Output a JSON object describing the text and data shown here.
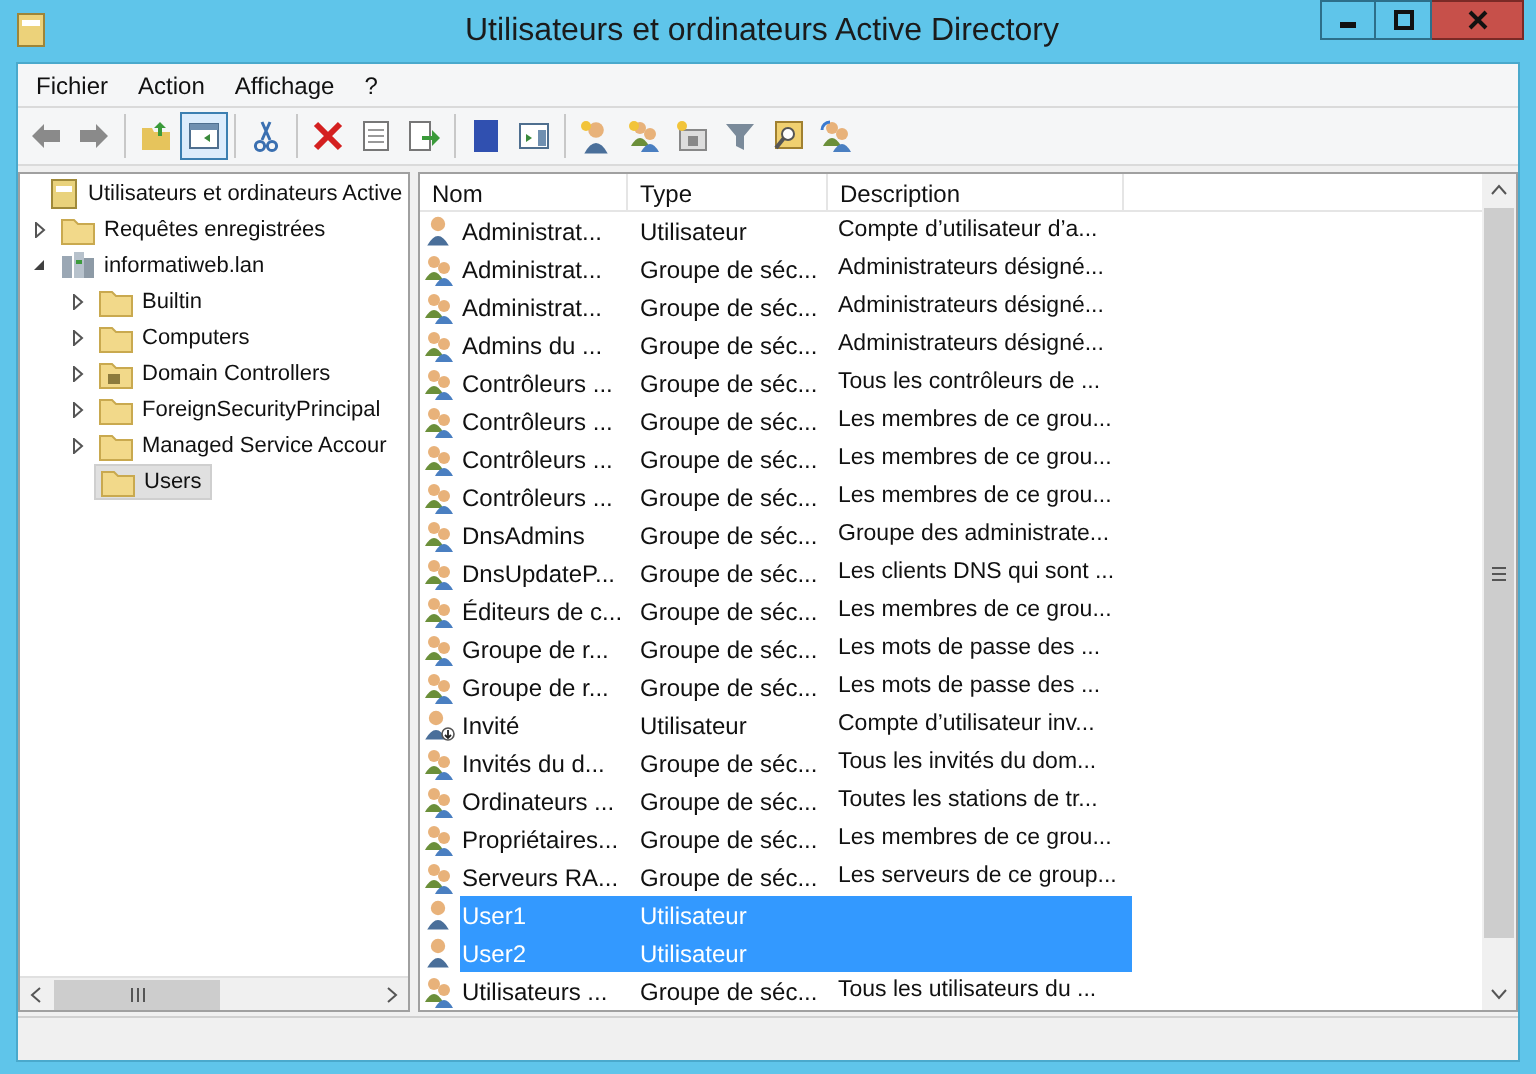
{
  "window": {
    "title": "Utilisateurs et ordinateurs Active Directory"
  },
  "menu": [
    "Fichier",
    "Action",
    "Affichage",
    "?"
  ],
  "tree": {
    "label": "Utilisateurs et ordinateurs Active",
    "kind": "root",
    "selected": false,
    "children": [
      {
        "label": "Requêtes enregistrées",
        "kind": "folder",
        "expanded": false,
        "selected": false
      },
      {
        "label": "informatiweb.lan",
        "kind": "domain",
        "expanded": true,
        "selected": false,
        "children": [
          {
            "label": "Builtin",
            "kind": "folder",
            "expanded": false,
            "selected": false
          },
          {
            "label": "Computers",
            "kind": "folder",
            "expanded": false,
            "selected": false
          },
          {
            "label": "Domain Controllers",
            "kind": "ou",
            "expanded": false,
            "selected": false
          },
          {
            "label": "ForeignSecurityPrincipal",
            "kind": "folder",
            "expanded": false,
            "selected": false
          },
          {
            "label": "Managed Service Accour",
            "kind": "folder",
            "expanded": false,
            "selected": false
          },
          {
            "label": "Users",
            "kind": "folder",
            "selected": true
          }
        ]
      }
    ]
  },
  "table": {
    "columns": [
      "Nom",
      "Type",
      "Description"
    ],
    "rows": [
      {
        "kind": "user",
        "name": "Administrat...",
        "type": "Utilisateur",
        "description": "Compte d’utilisateur d’a...",
        "selected": false
      },
      {
        "kind": "group",
        "name": "Administrat...",
        "type": "Groupe de séc...",
        "description": "Administrateurs désigné...",
        "selected": false
      },
      {
        "kind": "group",
        "name": "Administrat...",
        "type": "Groupe de séc...",
        "description": "Administrateurs désigné...",
        "selected": false
      },
      {
        "kind": "group",
        "name": "Admins du ...",
        "type": "Groupe de séc...",
        "description": "Administrateurs désigné...",
        "selected": false
      },
      {
        "kind": "group",
        "name": "Contrôleurs ...",
        "type": "Groupe de séc...",
        "description": "Tous les contrôleurs de ...",
        "selected": false
      },
      {
        "kind": "group",
        "name": "Contrôleurs ...",
        "type": "Groupe de séc...",
        "description": "Les membres de ce grou...",
        "selected": false
      },
      {
        "kind": "group",
        "name": "Contrôleurs ...",
        "type": "Groupe de séc...",
        "description": "Les membres de ce grou...",
        "selected": false
      },
      {
        "kind": "group",
        "name": "Contrôleurs ...",
        "type": "Groupe de séc...",
        "description": "Les membres de ce grou...",
        "selected": false
      },
      {
        "kind": "group",
        "name": "DnsAdmins",
        "type": "Groupe de séc...",
        "description": "Groupe des administrate...",
        "selected": false
      },
      {
        "kind": "group",
        "name": "DnsUpdateP...",
        "type": "Groupe de séc...",
        "description": "Les clients DNS qui sont ...",
        "selected": false
      },
      {
        "kind": "group",
        "name": "Éditeurs de c...",
        "type": "Groupe de séc...",
        "description": "Les membres de ce grou...",
        "selected": false
      },
      {
        "kind": "group",
        "name": "Groupe de r...",
        "type": "Groupe de séc...",
        "description": "Les mots de passe des ...",
        "selected": false
      },
      {
        "kind": "group",
        "name": "Groupe de r...",
        "type": "Groupe de séc...",
        "description": "Les mots de passe des ...",
        "selected": false
      },
      {
        "kind": "guest",
        "name": "Invité",
        "type": "Utilisateur",
        "description": "Compte d’utilisateur inv...",
        "selected": false
      },
      {
        "kind": "group",
        "name": "Invités du d...",
        "type": "Groupe de séc...",
        "description": "Tous les invités du dom...",
        "selected": false
      },
      {
        "kind": "group",
        "name": "Ordinateurs ...",
        "type": "Groupe de séc...",
        "description": "Toutes les stations de tr...",
        "selected": false
      },
      {
        "kind": "group",
        "name": "Propriétaires...",
        "type": "Groupe de séc...",
        "description": "Les membres de ce grou...",
        "selected": false
      },
      {
        "kind": "group",
        "name": "Serveurs RA...",
        "type": "Groupe de séc...",
        "description": "Les serveurs de ce group...",
        "selected": false
      },
      {
        "kind": "user",
        "name": "User1",
        "type": "Utilisateur",
        "selected": true
      },
      {
        "kind": "user",
        "name": "User2",
        "type": "Utilisateur",
        "selected": true
      },
      {
        "kind": "group",
        "name": "Utilisateurs ...",
        "type": "Groupe de séc...",
        "description": "Tous les utilisateurs du ...",
        "selected": false
      }
    ]
  }
}
